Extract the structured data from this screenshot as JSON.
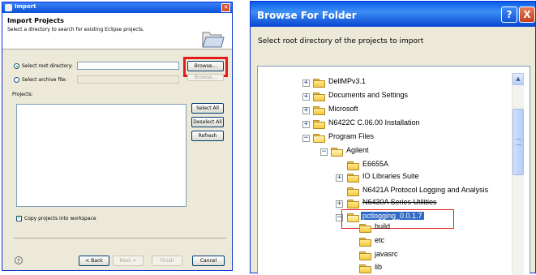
{
  "import_dialog": {
    "title": "Import",
    "heading": "Import Projects",
    "description": "Select a directory to search for existing Eclipse projects.",
    "select_root_label": "Select root directory:",
    "select_root_value": "",
    "select_archive_label": "Select archive file:",
    "select_archive_value": "",
    "browse_label": "Browse...",
    "browse_archive_label": "Browse...",
    "projects_label": "Projects:",
    "select_all_label": "Select All",
    "deselect_all_label": "Deselect All",
    "refresh_label": "Refresh",
    "copy_projects_label": "Copy projects into workspace",
    "copy_projects_checked": true,
    "back_label": "< Back",
    "next_label": "Next >",
    "finish_label": "Finish",
    "cancel_label": "Cancel",
    "help_icon": "question-mark-icon"
  },
  "browse_dialog": {
    "title": "Browse For Folder",
    "help_button": "?",
    "close_button": "X",
    "instruction": "Select root directory of the projects to import",
    "tree": {
      "dellmp": "DellMPv3.1",
      "documents": "Documents and Settings",
      "microsoft": "Microsoft",
      "n6422c": "N6422C C.06.00 Installation",
      "program_files": "Program Files",
      "agilent": "Agilent",
      "e6655a": "E6655A",
      "io_libraries": "IO Libraries Suite",
      "n6421a": "N6421A Protocol Logging and Analysis",
      "n6430a": "N6430A Series Utilities",
      "pctlogging": "pctlogging_0.0.1.7",
      "build": "build",
      "etc": "etc",
      "javasrc": "javasrc",
      "lib": "lib"
    }
  },
  "colors": {
    "titlebar_blue": "#0a5ee8",
    "selection_blue": "#316ac5",
    "highlight_red": "#e31b1b",
    "xp_face": "#ece9d8"
  }
}
